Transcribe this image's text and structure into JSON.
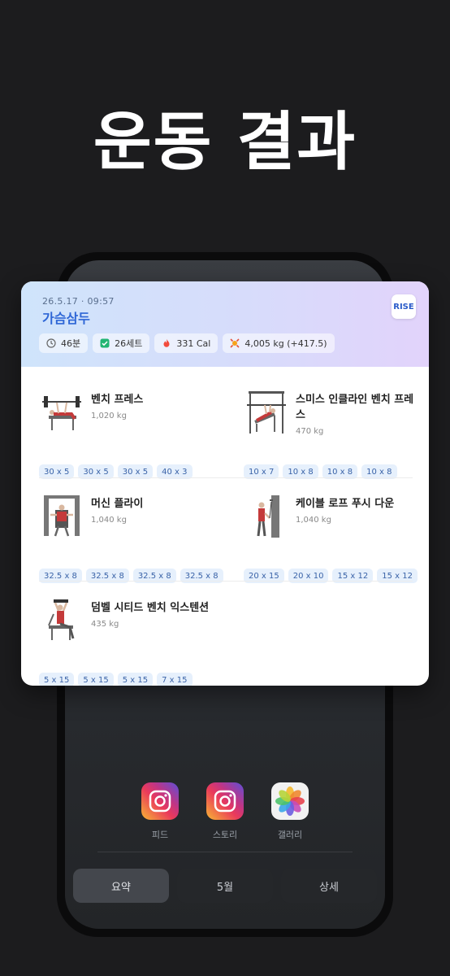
{
  "headline": "운동 결과",
  "card": {
    "date": "26.5.17 · 09:57",
    "title": "가슴삼두",
    "badge": "RISE",
    "stats": [
      {
        "icon": "clock-icon",
        "text": "46분"
      },
      {
        "icon": "check-icon",
        "text": "26세트"
      },
      {
        "icon": "flame-icon",
        "text": "331 Cal"
      },
      {
        "icon": "burst-icon",
        "text": "4,005 kg  (+417.5)"
      }
    ],
    "exercises": [
      {
        "name": "벤치 프레스",
        "weight": "1,020 kg",
        "sets": [
          "30 x 5",
          "30 x 5",
          "30 x 5",
          "40 x 3"
        ]
      },
      {
        "name": "스미스 인클라인 벤치 프레스",
        "weight": "470 kg",
        "sets": [
          "10 x 7",
          "10 x 8",
          "10 x 8",
          "10 x 8"
        ]
      },
      {
        "name": "머신 플라이",
        "weight": "1,040 kg",
        "sets": [
          "32.5 x 8",
          "32.5 x 8",
          "32.5 x 8",
          "32.5 x 8"
        ]
      },
      {
        "name": "케이블 로프 푸시 다운",
        "weight": "1,040 kg",
        "sets": [
          "20 x 15",
          "20 x 10",
          "15 x 12",
          "15 x 12"
        ]
      },
      {
        "name": "덤벨 시티드 벤치 익스텐션",
        "weight": "435 kg",
        "sets": [
          "5 x 15",
          "5 x 15",
          "5 x 15",
          "7 x 15"
        ]
      }
    ]
  },
  "share": [
    {
      "label": "피드",
      "icon": "instagram-icon"
    },
    {
      "label": "스토리",
      "icon": "instagram-icon"
    },
    {
      "label": "갤러리",
      "icon": "photos-icon"
    }
  ],
  "tabs": [
    "요약",
    "5월",
    "상세"
  ],
  "active_tab": "요약",
  "colors": {
    "accent": "#2e66d6",
    "set_chip": "#e6f0fc"
  }
}
